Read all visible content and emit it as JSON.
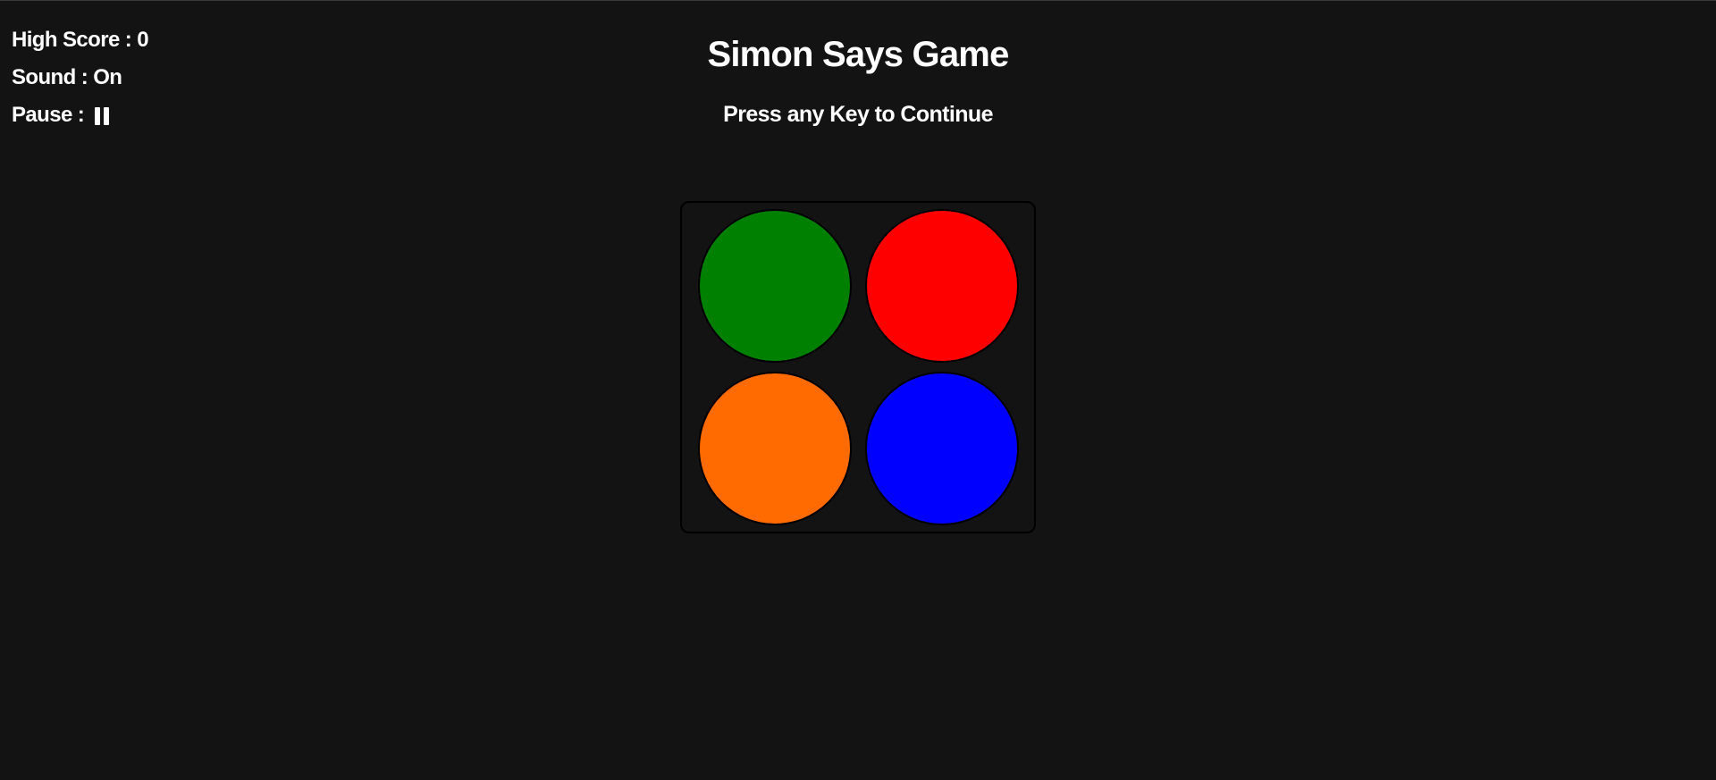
{
  "status": {
    "high_score_label": "High Score : ",
    "high_score_value": "0",
    "sound_label": "Sound : ",
    "sound_value": "On",
    "pause_label": "Pause : "
  },
  "header": {
    "title": "Simon Says Game",
    "subtitle": "Press any Key to Continue"
  },
  "colors": {
    "background": "#141314",
    "text": "#ffffff",
    "green": "#008000",
    "red": "#ff0000",
    "orange": "#ff6b00",
    "blue": "#0000ff"
  },
  "pads": [
    {
      "name": "green",
      "color": "#008000",
      "icon": "green-pad"
    },
    {
      "name": "red",
      "color": "#ff0000",
      "icon": "red-pad"
    },
    {
      "name": "orange",
      "color": "#ff6b00",
      "icon": "orange-pad"
    },
    {
      "name": "blue",
      "color": "#0000ff",
      "icon": "blue-pad"
    }
  ],
  "icons": {
    "pause": "pause-icon"
  }
}
